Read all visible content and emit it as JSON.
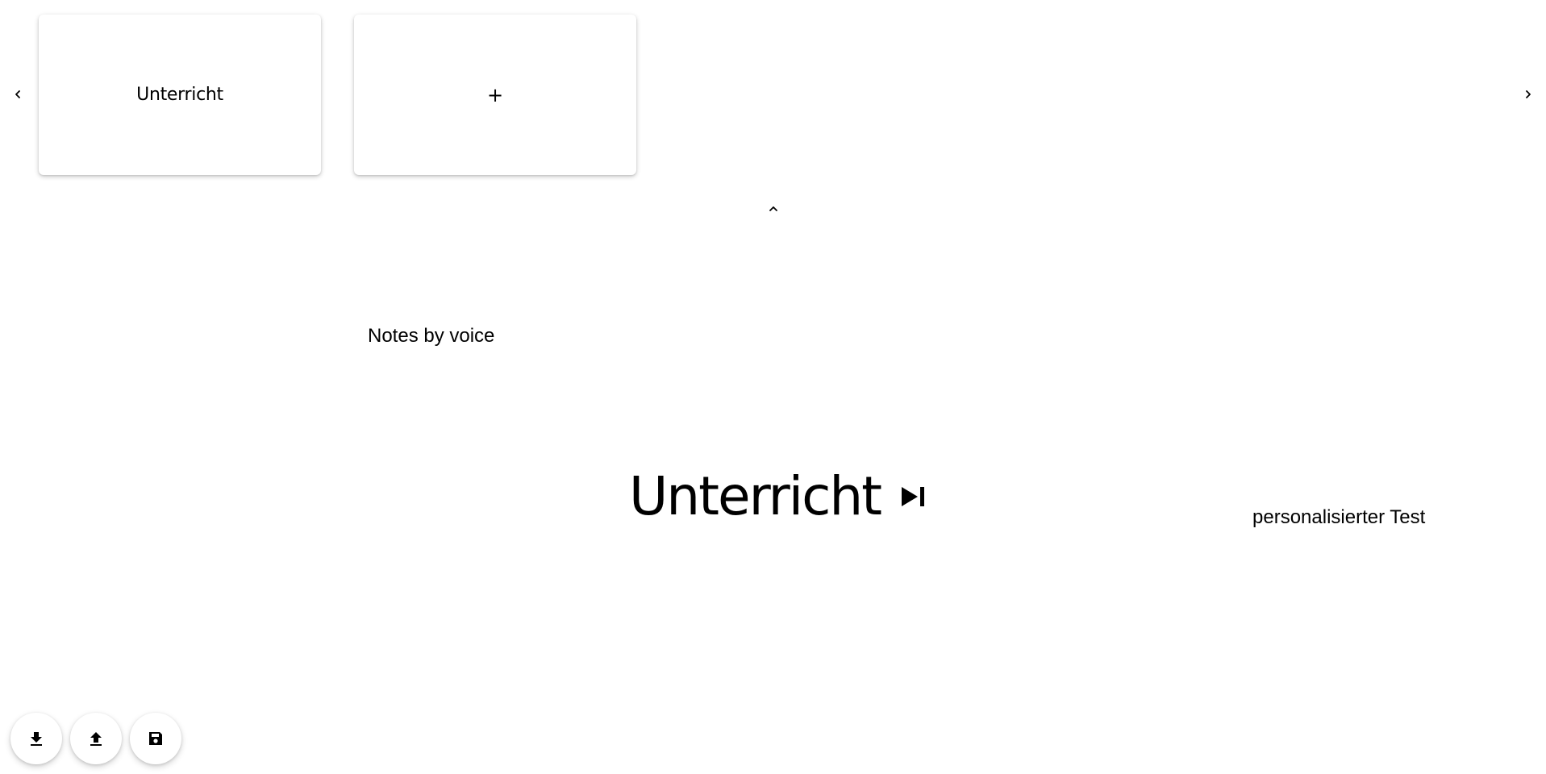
{
  "carousel": {
    "prev_icon": "chevron-left-icon",
    "next_icon": "chevron-right-icon",
    "cards": [
      {
        "label": "Unterricht"
      },
      {
        "label": "+"
      }
    ],
    "collapse_icon": "chevron-up-icon"
  },
  "main": {
    "notes_label": "Notes by voice",
    "current_title": "Unterricht",
    "skip_icon": "skip-next-icon",
    "side_label": "personalisierter Test"
  },
  "actions": {
    "download_icon": "download-icon",
    "upload_icon": "upload-icon",
    "save_icon": "save-icon"
  }
}
